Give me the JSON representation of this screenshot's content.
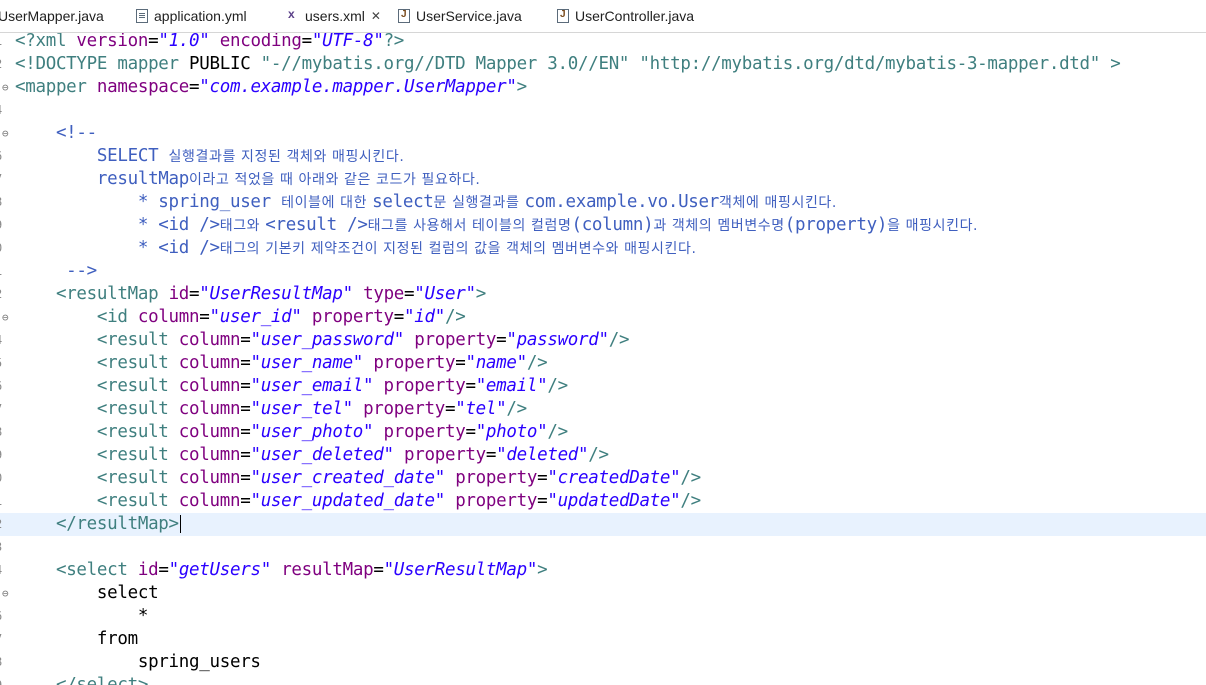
{
  "tabs": [
    {
      "label": "UserMapper.java",
      "icon": "java-file-icon",
      "active": false
    },
    {
      "label": "application.yml",
      "icon": "yml-file-icon",
      "active": false
    },
    {
      "label": "users.xml",
      "icon": "xml-file-icon",
      "active": true,
      "close": "✕"
    },
    {
      "label": "UserService.java",
      "icon": "java-file-icon",
      "active": false
    },
    {
      "label": "UserController.java",
      "icon": "java-file-icon",
      "active": false
    }
  ],
  "gutter": [
    "1",
    "2",
    "3",
    "4",
    "5",
    "6",
    "7",
    "8",
    "9",
    "0",
    "1",
    "2",
    "3",
    "4",
    "5",
    "6",
    "7",
    "8",
    "9",
    "0",
    "1",
    "2",
    "3",
    "4",
    "5",
    "6",
    "7",
    "8",
    "9",
    "0"
  ],
  "folds": {
    "3": "⊖",
    "5": "⊖",
    "13": "⊖",
    "25": "⊖"
  },
  "lines": [
    [
      [
        "tag",
        "<?xml "
      ],
      [
        "attr",
        "version"
      ],
      [
        "txt",
        "="
      ],
      [
        "str",
        "\"1.0\""
      ],
      [
        "txt",
        " "
      ],
      [
        "attr",
        "encoding"
      ],
      [
        "txt",
        "="
      ],
      [
        "str",
        "\"UTF-8\""
      ],
      [
        "tag",
        "?>"
      ]
    ],
    [
      [
        "tag",
        "<!DOCTYPE mapper "
      ],
      [
        "txt",
        "PUBLIC "
      ],
      [
        "tag",
        "\"-//mybatis.org//DTD Mapper 3.0//EN\" \"http://mybatis.org/dtd/mybatis-3-mapper.dtd\" >"
      ]
    ],
    [
      [
        "tag",
        "<mapper "
      ],
      [
        "attr",
        "namespace"
      ],
      [
        "txt",
        "="
      ],
      [
        "str",
        "\"com.example.mapper.UserMapper\""
      ],
      [
        "tag",
        ">"
      ]
    ],
    [],
    [
      [
        "com",
        "    <!--"
      ]
    ],
    [
      [
        "com",
        "        SELECT "
      ],
      [
        "comk",
        "실행결과를 지정된 객체와 매핑시킨다."
      ]
    ],
    [
      [
        "com",
        "        resultMap"
      ],
      [
        "comk",
        "이라고 적었을 때 아래와 같은 코드가 필요하다."
      ]
    ],
    [
      [
        "com",
        "            * spring_user "
      ],
      [
        "comk",
        "테이블에 대한 "
      ],
      [
        "com",
        "select"
      ],
      [
        "comk",
        "문 실행결과를 "
      ],
      [
        "com",
        "com.example.vo.User"
      ],
      [
        "comk",
        "객체에 매핑시킨다."
      ]
    ],
    [
      [
        "com",
        "            * <id />"
      ],
      [
        "comk",
        "태그와 "
      ],
      [
        "com",
        "<result />"
      ],
      [
        "comk",
        "태그를 사용해서 테이블의 컬럼명"
      ],
      [
        "com",
        "(column)"
      ],
      [
        "comk",
        "과 객체의 멤버변수명"
      ],
      [
        "com",
        "(property)"
      ],
      [
        "comk",
        "을 매핑시킨다."
      ]
    ],
    [
      [
        "com",
        "            * <id />"
      ],
      [
        "comk",
        "태그의 기본키 제약조건이 지정된 컬럼의 값을 객체의 멤버변수와 매핑시킨다."
      ]
    ],
    [
      [
        "com",
        "     -->"
      ]
    ],
    [
      [
        "txt",
        "    "
      ],
      [
        "tag",
        "<resultMap "
      ],
      [
        "attr",
        "id"
      ],
      [
        "txt",
        "="
      ],
      [
        "str",
        "\"UserResultMap\""
      ],
      [
        "txt",
        " "
      ],
      [
        "attr",
        "type"
      ],
      [
        "txt",
        "="
      ],
      [
        "str",
        "\"User\""
      ],
      [
        "tag",
        ">"
      ]
    ],
    [
      [
        "txt",
        "        "
      ],
      [
        "tag",
        "<id "
      ],
      [
        "attr",
        "column"
      ],
      [
        "txt",
        "="
      ],
      [
        "str",
        "\"user_id\""
      ],
      [
        "txt",
        " "
      ],
      [
        "attr",
        "property"
      ],
      [
        "txt",
        "="
      ],
      [
        "str",
        "\"id\""
      ],
      [
        "tag",
        "/>"
      ]
    ],
    [
      [
        "txt",
        "        "
      ],
      [
        "tag",
        "<result "
      ],
      [
        "attr",
        "column"
      ],
      [
        "txt",
        "="
      ],
      [
        "str",
        "\"user_password\""
      ],
      [
        "txt",
        " "
      ],
      [
        "attr",
        "property"
      ],
      [
        "txt",
        "="
      ],
      [
        "str",
        "\"password\""
      ],
      [
        "tag",
        "/>"
      ]
    ],
    [
      [
        "txt",
        "        "
      ],
      [
        "tag",
        "<result "
      ],
      [
        "attr",
        "column"
      ],
      [
        "txt",
        "="
      ],
      [
        "str",
        "\"user_name\""
      ],
      [
        "txt",
        " "
      ],
      [
        "attr",
        "property"
      ],
      [
        "txt",
        "="
      ],
      [
        "str",
        "\"name\""
      ],
      [
        "tag",
        "/>"
      ]
    ],
    [
      [
        "txt",
        "        "
      ],
      [
        "tag",
        "<result "
      ],
      [
        "attr",
        "column"
      ],
      [
        "txt",
        "="
      ],
      [
        "str",
        "\"user_email\""
      ],
      [
        "txt",
        " "
      ],
      [
        "attr",
        "property"
      ],
      [
        "txt",
        "="
      ],
      [
        "str",
        "\"email\""
      ],
      [
        "tag",
        "/>"
      ]
    ],
    [
      [
        "txt",
        "        "
      ],
      [
        "tag",
        "<result "
      ],
      [
        "attr",
        "column"
      ],
      [
        "txt",
        "="
      ],
      [
        "str",
        "\"user_tel\""
      ],
      [
        "txt",
        " "
      ],
      [
        "attr",
        "property"
      ],
      [
        "txt",
        "="
      ],
      [
        "str",
        "\"tel\""
      ],
      [
        "tag",
        "/>"
      ]
    ],
    [
      [
        "txt",
        "        "
      ],
      [
        "tag",
        "<result "
      ],
      [
        "attr",
        "column"
      ],
      [
        "txt",
        "="
      ],
      [
        "str",
        "\"user_photo\""
      ],
      [
        "txt",
        " "
      ],
      [
        "attr",
        "property"
      ],
      [
        "txt",
        "="
      ],
      [
        "str",
        "\"photo\""
      ],
      [
        "tag",
        "/>"
      ]
    ],
    [
      [
        "txt",
        "        "
      ],
      [
        "tag",
        "<result "
      ],
      [
        "attr",
        "column"
      ],
      [
        "txt",
        "="
      ],
      [
        "str",
        "\"user_deleted\""
      ],
      [
        "txt",
        " "
      ],
      [
        "attr",
        "property"
      ],
      [
        "txt",
        "="
      ],
      [
        "str",
        "\"deleted\""
      ],
      [
        "tag",
        "/>"
      ]
    ],
    [
      [
        "txt",
        "        "
      ],
      [
        "tag",
        "<result "
      ],
      [
        "attr",
        "column"
      ],
      [
        "txt",
        "="
      ],
      [
        "str",
        "\"user_created_date\""
      ],
      [
        "txt",
        " "
      ],
      [
        "attr",
        "property"
      ],
      [
        "txt",
        "="
      ],
      [
        "str",
        "\"createdDate\""
      ],
      [
        "tag",
        "/>"
      ]
    ],
    [
      [
        "txt",
        "        "
      ],
      [
        "tag",
        "<result "
      ],
      [
        "attr",
        "column"
      ],
      [
        "txt",
        "="
      ],
      [
        "str",
        "\"user_updated_date\""
      ],
      [
        "txt",
        " "
      ],
      [
        "attr",
        "property"
      ],
      [
        "txt",
        "="
      ],
      [
        "str",
        "\"updatedDate\""
      ],
      [
        "tag",
        "/>"
      ]
    ],
    [
      [
        "txt",
        "    "
      ],
      [
        "tag",
        "</resultMap>"
      ]
    ],
    [],
    [
      [
        "txt",
        "    "
      ],
      [
        "tag",
        "<select "
      ],
      [
        "attr",
        "id"
      ],
      [
        "txt",
        "="
      ],
      [
        "str",
        "\"getUsers\""
      ],
      [
        "txt",
        " "
      ],
      [
        "attr",
        "resultMap"
      ],
      [
        "txt",
        "="
      ],
      [
        "str",
        "\"UserResultMap\""
      ],
      [
        "tag",
        ">"
      ]
    ],
    [
      [
        "txt",
        "        select"
      ]
    ],
    [
      [
        "txt",
        "            *"
      ]
    ],
    [
      [
        "txt",
        "        from"
      ]
    ],
    [
      [
        "txt",
        "            spring_users"
      ]
    ],
    [
      [
        "txt",
        "    "
      ],
      [
        "tag",
        "</select>"
      ]
    ]
  ],
  "highlight_line": 22,
  "colors": {
    "tag": "#3f7f7f",
    "attr": "#7f007f",
    "string": "#2a00ff",
    "comment": "#3f5fbf",
    "current_line": "#e8f2fe"
  }
}
